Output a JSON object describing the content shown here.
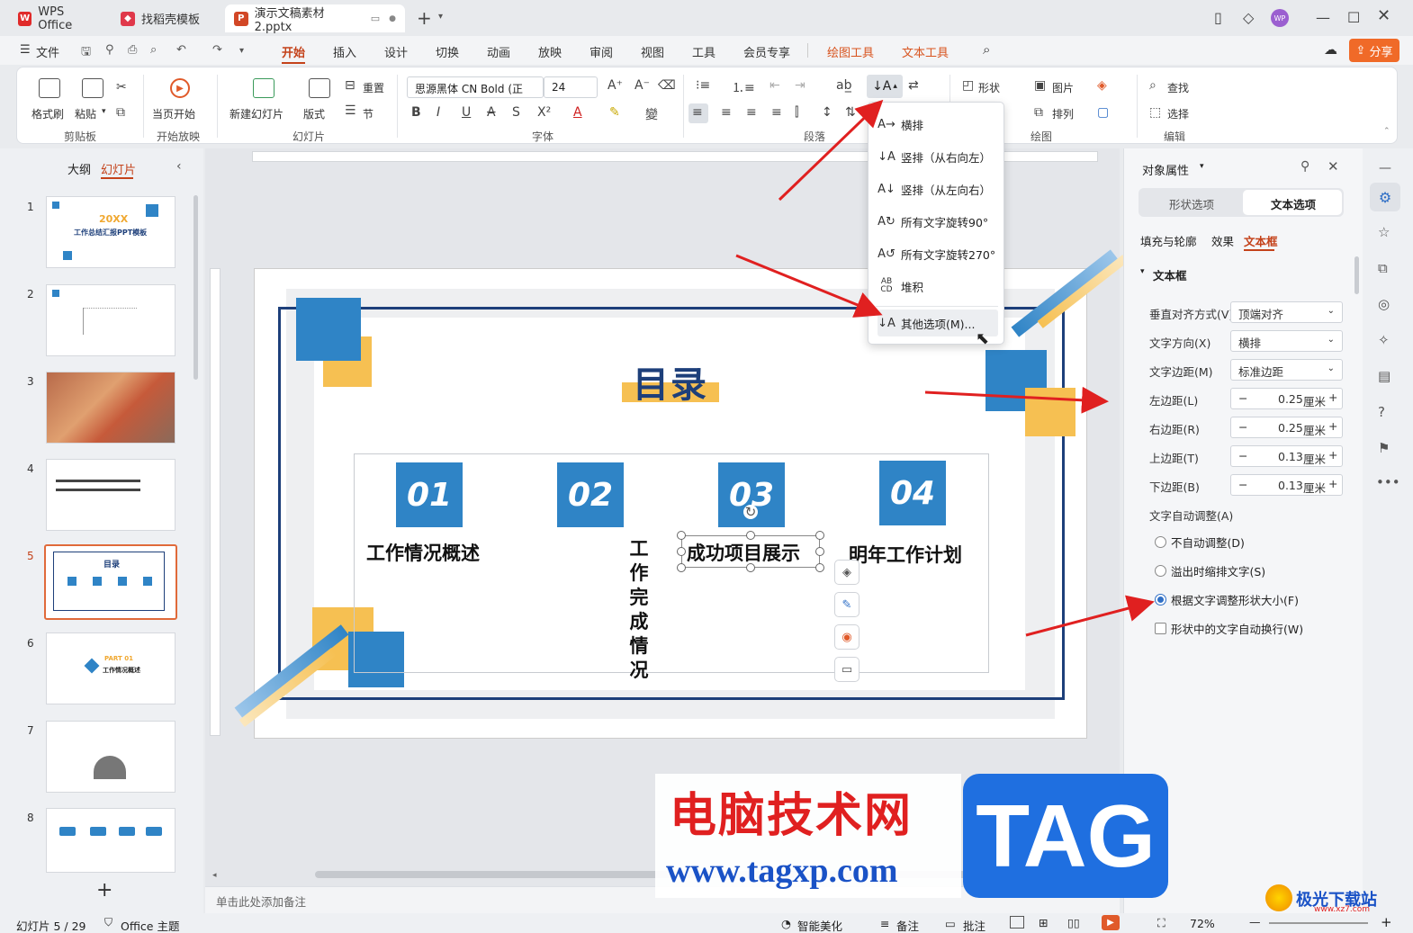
{
  "titlebar": {
    "tabs": [
      {
        "label": "WPS Office",
        "icon": "wps-logo-icon"
      },
      {
        "label": "找稻壳模板",
        "icon": "docer-icon"
      },
      {
        "label": "演示文稿素材2.pptx",
        "icon": "presentation-icon"
      }
    ],
    "avatar": "WP"
  },
  "menubar": {
    "file": "文件",
    "items": [
      "开始",
      "插入",
      "设计",
      "切换",
      "动画",
      "放映",
      "审阅",
      "视图",
      "工具",
      "会员专享"
    ],
    "context": [
      "绘图工具",
      "文本工具"
    ],
    "share": "分享"
  },
  "ribbon": {
    "format_painter": "格式刷",
    "paste": "粘贴",
    "clipboard_group": "剪贴板",
    "play_from_current": "当页开始",
    "play_group": "开始放映",
    "new_slide": "新建幻灯片",
    "layout": "版式",
    "reset": "重置",
    "section": "节",
    "slide_group": "幻灯片",
    "font_name": "思源黑体 CN Bold (正",
    "font_size": "24",
    "font_group": "字体",
    "paragraph_group": "段落",
    "shape": "形状",
    "picture": "图片",
    "arrange": "排列",
    "drawing_group": "绘图",
    "find": "查找",
    "select": "选择",
    "edit_group": "编辑"
  },
  "text_direction_menu": {
    "items": [
      "横排",
      "竖排（从右向左）",
      "竖排（从左向右）",
      "所有文字旋转90°",
      "所有文字旋转270°",
      "堆积",
      "其他选项(M)..."
    ]
  },
  "leftpanel": {
    "tab_outline": "大纲",
    "tab_slides": "幻灯片",
    "slide_numbers": [
      "1",
      "2",
      "3",
      "4",
      "5",
      "6",
      "7",
      "8"
    ],
    "thumb1_year": "20XX",
    "thumb1_title": "工作总结汇报PPT模板",
    "thumb5_title": "目录",
    "thumb6_part": "PART 01",
    "thumb6_title": "工作情况概述"
  },
  "slide": {
    "title": "目录",
    "items": [
      {
        "num": "01",
        "label": "工作情况概述"
      },
      {
        "num": "02",
        "label": "工作完成情况"
      },
      {
        "num": "03",
        "label": "成功项目展示"
      },
      {
        "num": "04",
        "label": "明年工作计划"
      }
    ]
  },
  "notes_placeholder": "单击此处添加备注",
  "rightpanel": {
    "title": "对象属性",
    "tab_shape": "形状选项",
    "tab_text": "文本选项",
    "subtabs": [
      "填充与轮廓",
      "效果",
      "文本框"
    ],
    "section": "文本框",
    "vertical_align_label": "垂直对齐方式(V)",
    "vertical_align_value": "顶端对齐",
    "direction_label": "文字方向(X)",
    "direction_value": "横排",
    "margin_label": "文字边距(M)",
    "margin_value": "标准边距",
    "left_label": "左边距(L)",
    "left_value": "0.25",
    "right_label": "右边距(R)",
    "right_value": "0.25",
    "top_label": "上边距(T)",
    "top_value": "0.13",
    "bottom_label": "下边距(B)",
    "bottom_value": "0.13",
    "unit": "厘米",
    "autofit_label": "文字自动调整(A)",
    "opt_none": "不自动调整(D)",
    "opt_shrink": "溢出时缩排文字(S)",
    "opt_resize": "根据文字调整形状大小(F)",
    "opt_wrap": "形状中的文字自动换行(W)"
  },
  "statusbar": {
    "slide_info": "幻灯片 5 / 29",
    "theme": "Office 主题",
    "beautify": "智能美化",
    "notes": "备注",
    "comment": "批注",
    "zoom": "72%"
  },
  "watermark": {
    "site_cn": "电脑技术网",
    "tag": "TAG",
    "url": "www.tagxp.com",
    "corner_cn": "极光下载站",
    "corner_url": "www.xz7.com"
  },
  "colors": {
    "accent_orange": "#c4421a",
    "slide_blue": "#2f84c6",
    "slide_navy": "#1d3f7a",
    "slide_yellow": "#f6c052",
    "arrow_red": "#e02020"
  }
}
